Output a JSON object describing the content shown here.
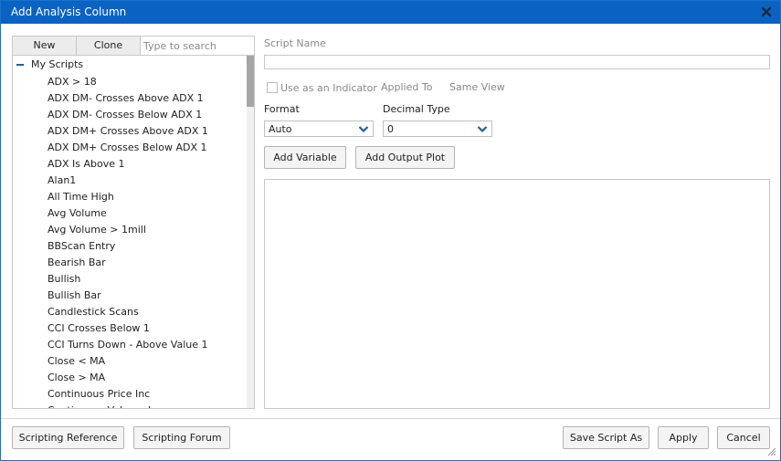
{
  "window": {
    "title": "Add Analysis Column",
    "close_icon": "close-icon"
  },
  "left_panel": {
    "new_label": "New",
    "clone_label": "Clone",
    "search_placeholder": "Type to search",
    "tree_root_label": "My Scripts",
    "items": [
      "ADX > 18",
      "ADX DM- Crosses Above ADX 1",
      "ADX DM- Crosses Below ADX 1",
      "ADX DM+ Crosses Above ADX 1",
      "ADX DM+ Crosses Below ADX 1",
      "ADX Is Above 1",
      "Alan1",
      "All Time High",
      "Avg Volume",
      "Avg Volume > 1mill",
      "BBScan Entry",
      "Bearish Bar",
      "Bullish",
      "Bullish Bar",
      "Candlestick Scans",
      "CCI Crosses Below 1",
      "CCI Turns Down - Above Value 1",
      "Close < MA",
      "Close > MA",
      "Continuous Price Inc",
      "Continuous Volume Inc"
    ]
  },
  "right_panel": {
    "script_name_label": "Script Name",
    "script_name_value": "",
    "use_as_indicator_label": "Use as an Indicator",
    "applied_to_label": "Applied To",
    "applied_to_value": "Same View",
    "format_label": "Format",
    "format_value": "Auto",
    "decimal_type_label": "Decimal Type",
    "decimal_type_value": "0",
    "add_variable_label": "Add Variable",
    "add_output_plot_label": "Add Output Plot"
  },
  "footer": {
    "scripting_reference_label": "Scripting Reference",
    "scripting_forum_label": "Scripting Forum",
    "save_script_as_label": "Save Script As",
    "apply_label": "Apply",
    "cancel_label": "Cancel"
  },
  "colors": {
    "titlebar": "#0a63c3",
    "tree_expander": "#1a5fa8",
    "select_chevron": "#1a5fa8"
  }
}
